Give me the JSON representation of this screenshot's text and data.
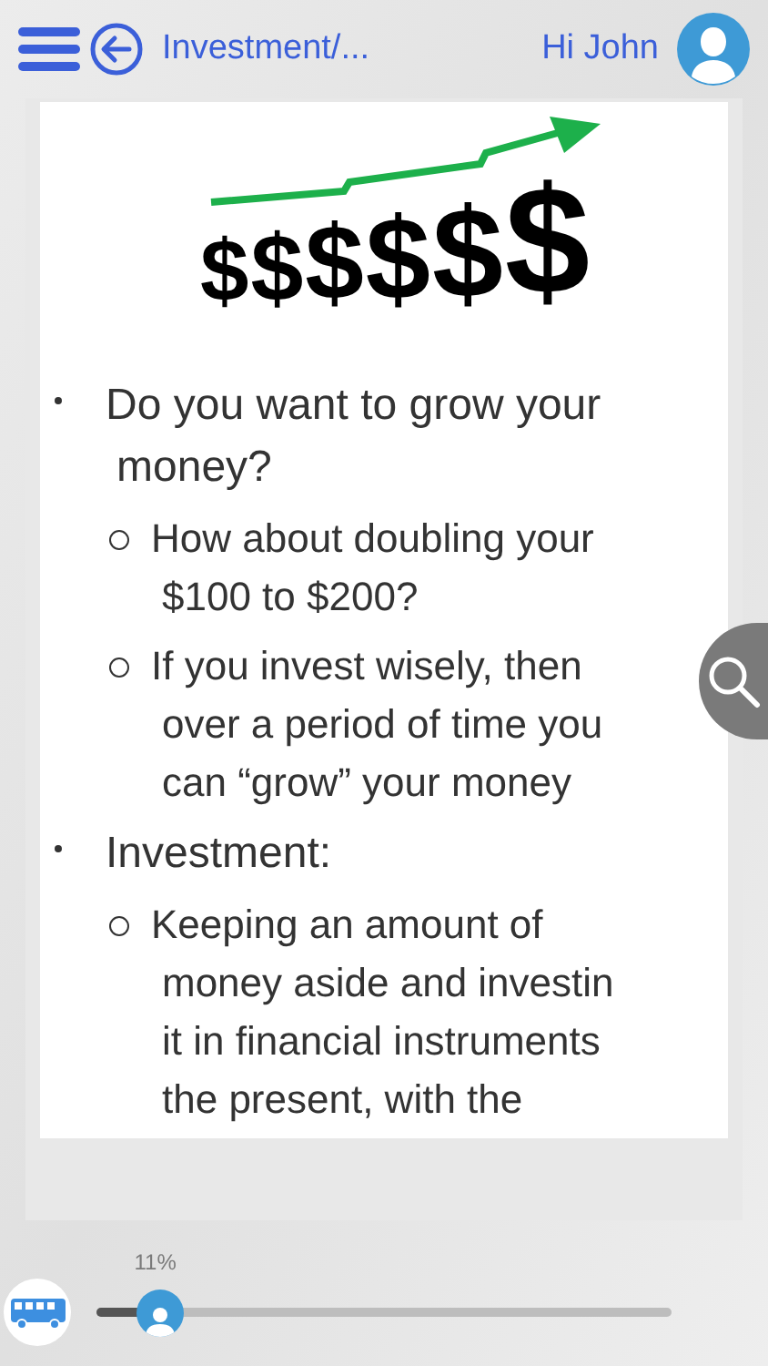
{
  "header": {
    "title": "Investment/...",
    "greeting": "Hi John"
  },
  "slide": {
    "graphic_symbols": [
      "$",
      "$",
      "$",
      "$",
      "$",
      "$"
    ],
    "bullets": [
      {
        "lines": [
          "Do you want to grow your",
          "money?"
        ],
        "children": [
          {
            "lines": [
              "How about doubling your",
              "$100 to $200?"
            ]
          },
          {
            "lines": [
              "If you invest wisely, then",
              "over a period of time you",
              "can “grow” your money"
            ]
          }
        ]
      },
      {
        "lines": [
          "Investment:"
        ],
        "children": [
          {
            "lines": [
              "Keeping an amount of",
              "money aside and investin",
              "it in financial instruments",
              "the present, with the"
            ]
          }
        ]
      }
    ]
  },
  "progress": {
    "reading": "11%",
    "level": 0.11
  }
}
